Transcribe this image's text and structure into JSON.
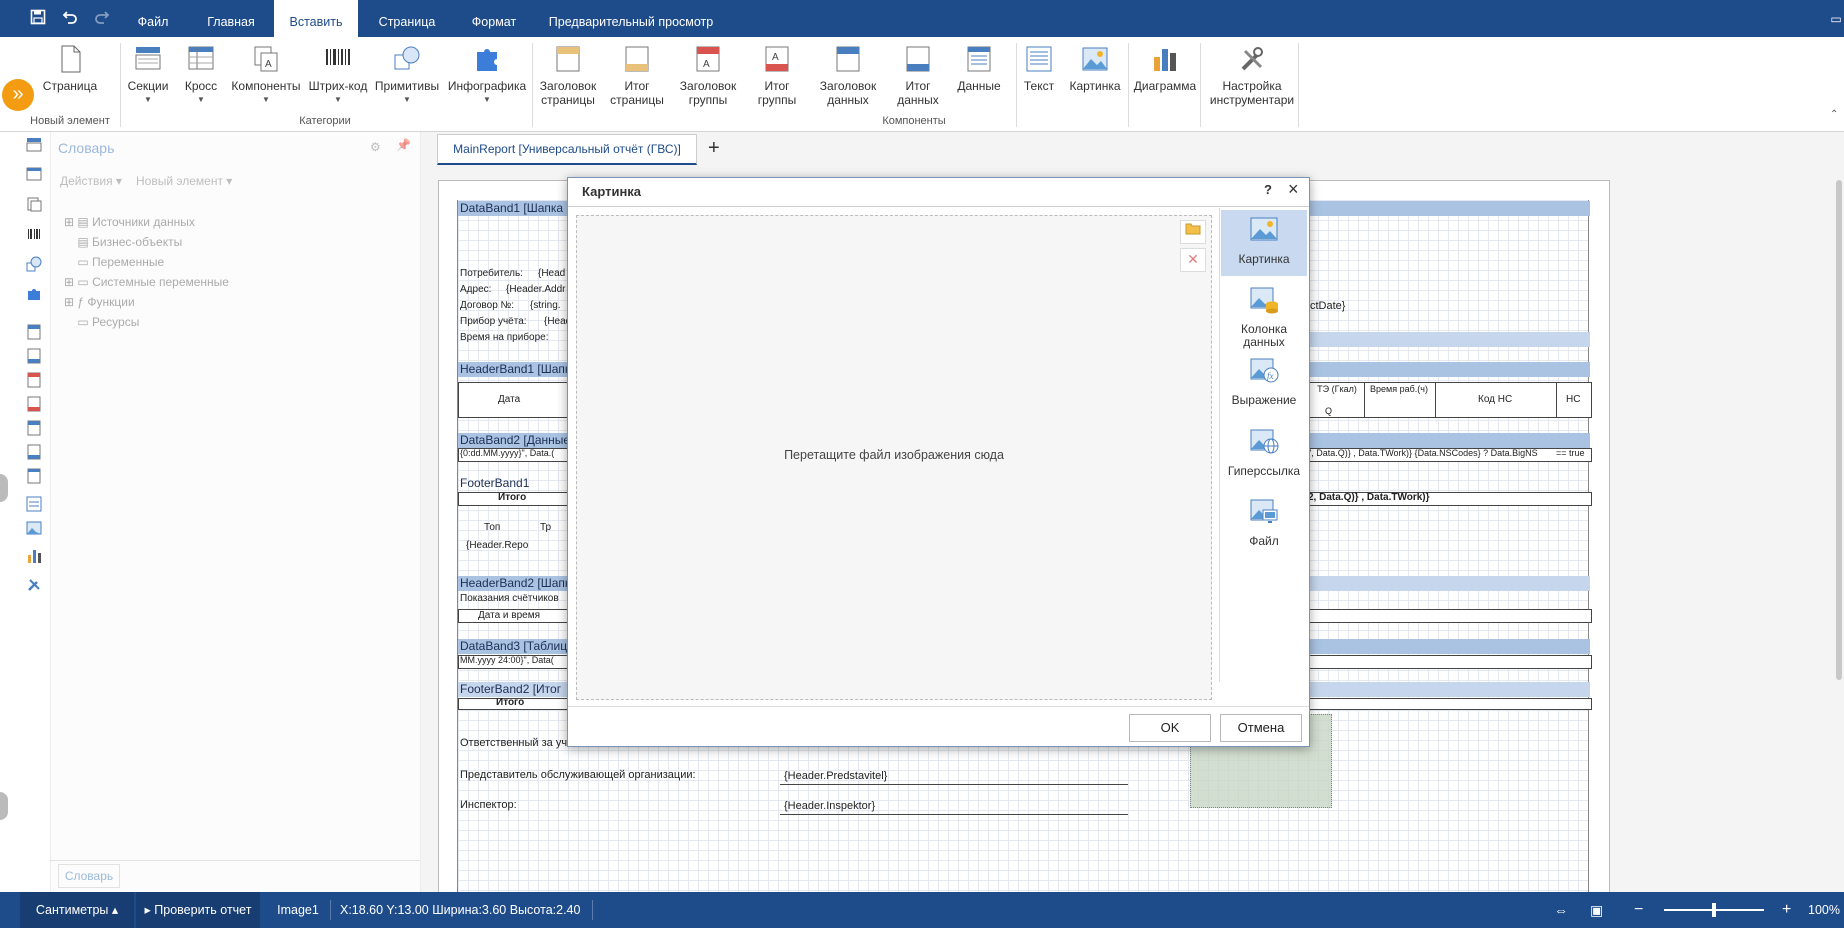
{
  "menu": {
    "tabs": [
      "Файл",
      "Главная",
      "Вставить",
      "Страница",
      "Формат",
      "Предварительный просмотр"
    ],
    "active_index": 2
  },
  "ribbon": {
    "page": "Страница",
    "sections": "Секции",
    "cross": "Кросс",
    "components": "Компоненты",
    "barcode": "Штрих-код",
    "primitives": "Примитивы",
    "infographics": "Инфографика",
    "page_header_1": "Заголовок",
    "page_header_2": "страницы",
    "page_footer_1": "Итог",
    "page_footer_2": "страницы",
    "group_header_1": "Заголовок",
    "group_header_2": "группы",
    "group_footer_1": "Итог",
    "group_footer_2": "группы",
    "data_header_1": "Заголовок",
    "data_header_2": "данных",
    "data_footer_1": "Итог",
    "data_footer_2": "данных",
    "data": "Данные",
    "text": "Текст",
    "image": "Картинка",
    "chart": "Диаграмма",
    "tools_1": "Настройка",
    "tools_2": "инструментари",
    "group_new": "Новый элемент",
    "group_categories": "Категории",
    "group_components": "Компоненты"
  },
  "dictionary": {
    "title": "Словарь",
    "actions": "Действия",
    "new_item": "Новый элемент",
    "tree": [
      "Источники данных",
      "Бизнес-объекты",
      "Переменные",
      "Системные переменные",
      "Функции",
      "Ресурсы"
    ],
    "bottom_tab": "Словарь"
  },
  "doc_tab": "MainReport [Универсальный отчёт (ГВС)]",
  "report": {
    "band1": "DataBand1 [Шапка",
    "consumer": "Потребитель:",
    "consumer_val": "{Head",
    "address": "Адрес:",
    "address_val": "{Header.Addr",
    "contract": "Договор №:",
    "contract_val": "{string.",
    "meter": "Прибор учёта:",
    "meter_val": "{Head",
    "time": "Время на приборе:",
    "right_date": "ctDate}",
    "band2": "HeaderBand1 [Шапк",
    "col_date": "Дата",
    "col_te": "ТЭ (Гкал)",
    "col_q": "Q",
    "col_time": "Время раб.(ч)",
    "col_ns": "Код НС",
    "col_nc": "НС",
    "band3": "DataBand2 [Данные",
    "row_left": "{0:dd.MM.yyyy}\", Data.(",
    "row_right": "\", Data.Q)} , Data.TWork)} {Data.NSCodes} ? Data.BigNS",
    "row_true": "== true",
    "band4": "FooterBand1",
    "total": "Итого",
    "total_right": "2, Data.Q)} , Data.TWork)}",
    "top_label": "Топ",
    "tr_label": "Тр",
    "header_repo": "{Header.Repo",
    "band5": "HeaderBand2 [Шапк",
    "meter_readings": "Показания счётчиков",
    "date_time": "Дата и время",
    "band6": "DataBand3 [Таблиц",
    "band6_row": "MM.yyyy 24:00}\", Data(",
    "band7": "FooterBand2 [Итог",
    "total2": "Итого",
    "responsible": "Ответственный за уче",
    "rep_org": "Представитель обслуживающей организации:",
    "rep_val": "{Header.Predstavitel}",
    "inspector": "Инспектор:",
    "inspector_val": "{Header.Inspektor}"
  },
  "dialog": {
    "title": "Картинка",
    "help": "?",
    "close": "×",
    "drop_hint": "Перетащите файл изображения сюда",
    "options": [
      "Картинка",
      "Колонка данных",
      "Выражение",
      "Гиперссылка",
      "Файл"
    ],
    "ok": "OK",
    "cancel": "Отмена"
  },
  "status": {
    "units": "Сантиметры",
    "check": "Проверить отчет",
    "component": "Image1",
    "coords": "X:18.60 Y:13.00 Ширина:3.60 Высота:2.40",
    "zoom": "100%",
    "zoom_level": 0.5
  },
  "colors": {
    "primary": "#1e4b8a",
    "accent": "#f39c12",
    "band": "#aac3e3",
    "selected_opt": "#c9daf0"
  }
}
